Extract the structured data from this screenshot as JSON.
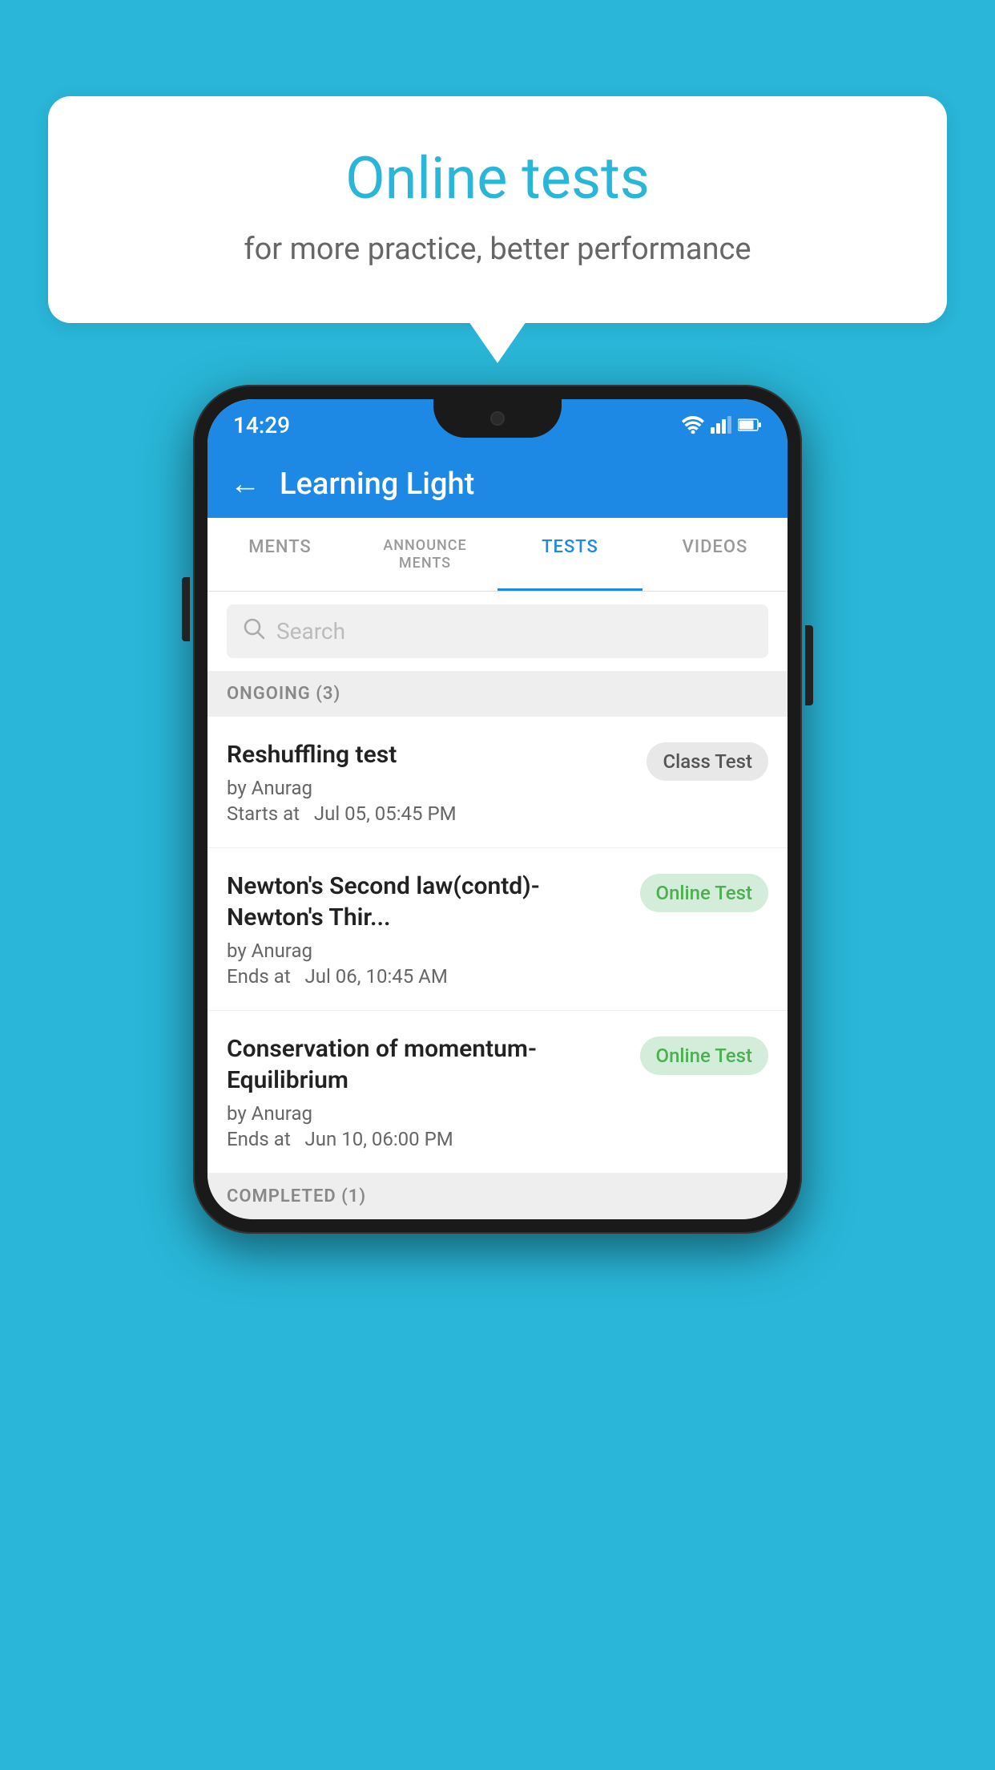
{
  "background_color": "#29b6d8",
  "speech_bubble": {
    "title": "Online tests",
    "subtitle": "for more practice, better performance"
  },
  "phone": {
    "status_bar": {
      "time": "14:29"
    },
    "app_header": {
      "title": "Learning Light",
      "back_label": "←"
    },
    "tabs": [
      {
        "label": "MENTS",
        "active": false
      },
      {
        "label": "ANNOUNCEMENTS",
        "active": false
      },
      {
        "label": "TESTS",
        "active": true
      },
      {
        "label": "VIDEOS",
        "active": false
      }
    ],
    "search": {
      "placeholder": "Search"
    },
    "ongoing_section": {
      "header": "ONGOING (3)",
      "items": [
        {
          "name": "Reshuffling test",
          "author": "by Anurag",
          "time_label": "Starts at",
          "time": "Jul 05, 05:45 PM",
          "badge": "Class Test",
          "badge_type": "class"
        },
        {
          "name": "Newton's Second law(contd)-Newton's Thir...",
          "author": "by Anurag",
          "time_label": "Ends at",
          "time": "Jul 06, 10:45 AM",
          "badge": "Online Test",
          "badge_type": "online"
        },
        {
          "name": "Conservation of momentum-Equilibrium",
          "author": "by Anurag",
          "time_label": "Ends at",
          "time": "Jun 10, 06:00 PM",
          "badge": "Online Test",
          "badge_type": "online"
        }
      ]
    },
    "completed_section": {
      "header": "COMPLETED (1)"
    }
  }
}
